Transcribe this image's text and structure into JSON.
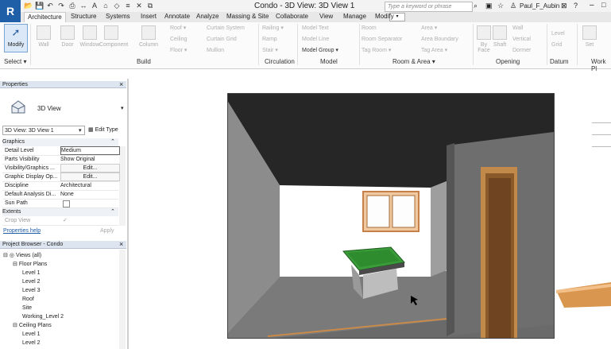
{
  "titlebar": {
    "app_letter": "R",
    "window_title": "Condo - 3D View: 3D View 1",
    "search_placeholder": "Type a keyword or phrase",
    "user_name": "Paul_F_Aubin",
    "qat_icons": [
      "open-icon",
      "save-icon",
      "undo-icon",
      "redo-icon",
      "print-icon",
      "measure-icon",
      "text-icon",
      "3d-view-icon",
      "section-icon",
      "thin-lines-icon",
      "close-hidden-icon",
      "switch-windows-icon"
    ]
  },
  "tabs": [
    "Architecture",
    "Structure",
    "Systems",
    "Insert",
    "Annotate",
    "Analyze",
    "Massing & Site",
    "Collaborate",
    "View",
    "Manage",
    "Modify"
  ],
  "ribbon": {
    "modify_label": "Modify",
    "select_label": "Select ▾",
    "build_big": [
      "Wall",
      "Door",
      "Window",
      "Component",
      "Column"
    ],
    "build_small": [
      "Roof ▾",
      "Ceiling",
      "Floor ▾",
      "Curtain System",
      "Curtain Grid",
      "Mullion"
    ],
    "build_label": "Build",
    "circulation_small": [
      "Railing ▾",
      "Ramp",
      "Stair ▾"
    ],
    "circulation_label": "Circulation",
    "model_small": [
      "Model Text",
      "Model Line",
      "Model Group ▾"
    ],
    "model_label": "Model",
    "room_small": [
      "Room",
      "Room Separator",
      "Tag Room ▾",
      "Area ▾",
      "Area Boundary",
      "Tag Area ▾"
    ],
    "room_label": "Room & Area ▾",
    "opening_big": [
      "By Face",
      "Shaft"
    ],
    "opening_small": [
      "Wall",
      "Vertical",
      "Dormer"
    ],
    "opening_label": "Opening",
    "datum_small": [
      "Level",
      "Grid"
    ],
    "datum_label": "Datum",
    "workplane_big": [
      "Set"
    ],
    "workplane_label": "Work Pl"
  },
  "properties": {
    "title": "Properties",
    "type_name": "3D View",
    "instance_selector": "3D View: 3D View 1",
    "edit_type": "Edit Type",
    "group_graphics": "Graphics",
    "rows": [
      {
        "k": "Detail Level",
        "v": "Medium"
      },
      {
        "k": "Parts Visibility",
        "v": "Show Original"
      },
      {
        "k": "Visibility/Graphics ...",
        "v": "Edit..."
      },
      {
        "k": "Graphic Display Op...",
        "v": "Edit..."
      },
      {
        "k": "Discipline",
        "v": "Architectural"
      },
      {
        "k": "Default Analysis Di...",
        "v": "None"
      },
      {
        "k": "Sun Path",
        "v": ""
      }
    ],
    "group_extents": "Extents",
    "crop_view": "Crop View",
    "help_link": "Properties help",
    "apply": "Apply"
  },
  "project_browser": {
    "title": "Project Browser - Condo",
    "tree": [
      {
        "label": "Views (all)",
        "level": 0,
        "expander": "⊟"
      },
      {
        "label": "Floor Plans",
        "level": 1,
        "expander": "⊟"
      },
      {
        "label": "Level 1",
        "level": 2,
        "expander": ""
      },
      {
        "label": "Level 2",
        "level": 2,
        "expander": ""
      },
      {
        "label": "Level 3",
        "level": 2,
        "expander": ""
      },
      {
        "label": "Roof",
        "level": 2,
        "expander": ""
      },
      {
        "label": "Site",
        "level": 2,
        "expander": ""
      },
      {
        "label": "Working_Level 2",
        "level": 2,
        "expander": ""
      },
      {
        "label": "Ceiling Plans",
        "level": 1,
        "expander": "⊟"
      },
      {
        "label": "Level 1",
        "level": 2,
        "expander": ""
      },
      {
        "label": "Level 2",
        "level": 2,
        "expander": ""
      }
    ]
  },
  "colors": {
    "accent": "#1f5fa8",
    "panel_header": "#dde6f0",
    "pool_felt": "#2e8b2e",
    "ceiling": "#262626",
    "floor": "#7a7a7a",
    "wall_right": "#6e6e6e",
    "door_wood": "#8a5a2b"
  }
}
